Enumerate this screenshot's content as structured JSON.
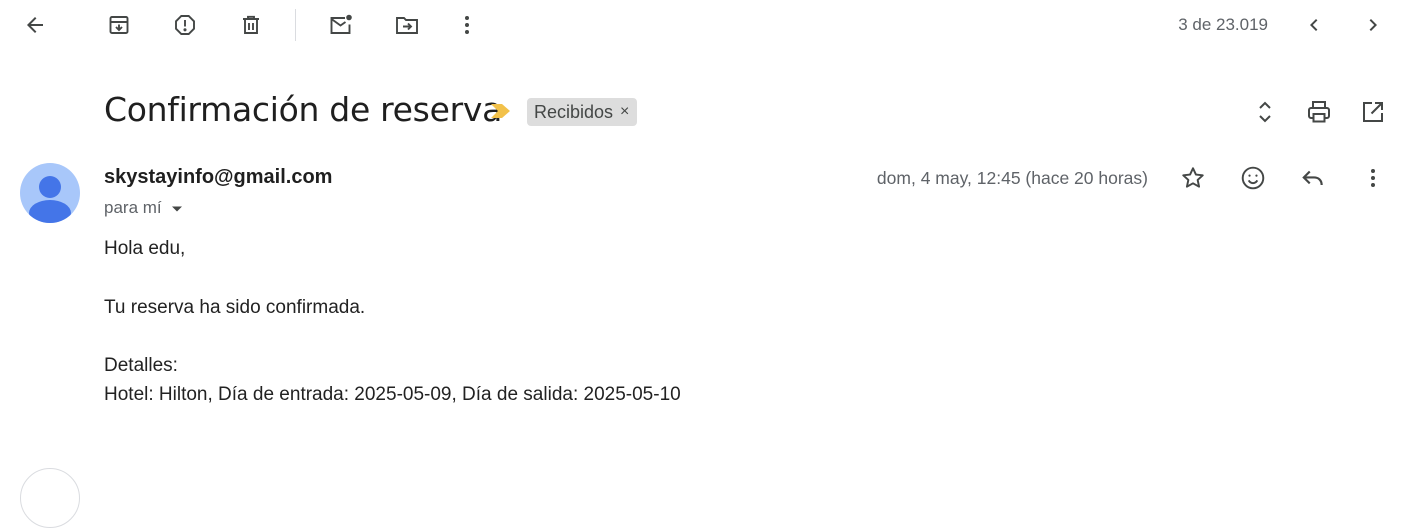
{
  "toolbar": {
    "icons": [
      "back-arrow-icon",
      "archive-icon",
      "report-spam-icon",
      "delete-icon",
      "mark-unread-icon",
      "move-to-icon",
      "more-vert-icon"
    ],
    "pager_text": "3 de 23.019",
    "pager_icons": [
      "chevron-left-icon",
      "chevron-right-icon"
    ]
  },
  "message": {
    "subject": "Confirmación de reserva",
    "label": "Recibidos",
    "label_remove": "×",
    "header_icons": [
      "expand-collapse-icon",
      "print-icon",
      "open-in-new-icon"
    ]
  },
  "sender": {
    "email": "skystayinfo@gmail.com",
    "recipient": "para mí",
    "date": "dom, 4 may, 12:45 (hace 20 horas)",
    "actions": [
      "star-icon",
      "emoji-reaction-icon",
      "reply-icon",
      "more-vert-icon"
    ]
  },
  "body": {
    "greeting": "Hola edu,",
    "line1": "Tu reserva ha sido confirmada.",
    "details_heading": "Detalles:",
    "details": "Hotel: Hilton, Día de entrada: 2025-05-09, Día de salida: 2025-05-10"
  },
  "colors": {
    "icon": "#444746",
    "muted_text": "#5f6368",
    "avatar_bg": "#a8c7fa",
    "avatar_fg": "#4475e8",
    "importance": "#f2c14a",
    "chip_bg": "#dddddd"
  }
}
